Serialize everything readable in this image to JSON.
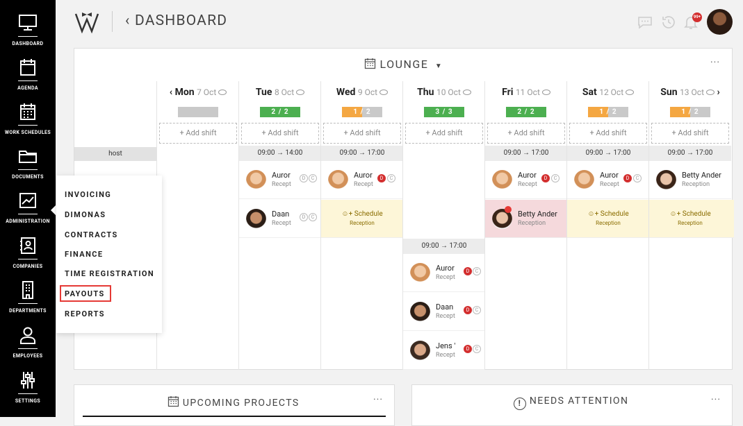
{
  "sidebar": {
    "items": [
      {
        "label": "DASHBOARD",
        "icon": "monitor-icon"
      },
      {
        "label": "AGENDA",
        "icon": "calendar-icon"
      },
      {
        "label": "WORK SCHEDULES",
        "icon": "schedule-grid-icon"
      },
      {
        "label": "DOCUMENTS",
        "icon": "folder-icon"
      },
      {
        "label": "ADMINISTRATION",
        "icon": "chart-icon"
      },
      {
        "label": "COMPANIES",
        "icon": "contact-book-icon"
      },
      {
        "label": "DEPARTMENTS",
        "icon": "building-icon"
      },
      {
        "label": "EMPLOYEES",
        "icon": "person-icon"
      },
      {
        "label": "SETTINGS",
        "icon": "sliders-icon"
      }
    ]
  },
  "header": {
    "title": "DASHBOARD",
    "notification_badge": "99+"
  },
  "schedule": {
    "location": "LOUNGE",
    "row_label": "host",
    "days": [
      {
        "day": "Mon",
        "date": "7 Oct",
        "bar": "",
        "bar_color": "#c9c9c9",
        "add": "+ Add shift",
        "time_start": "",
        "time_end": ""
      },
      {
        "day": "Tue",
        "date": "8 Oct",
        "bar": "2 / 2",
        "bar_color": "#4caf50",
        "add": "+ Add shift",
        "time_start": "09:00",
        "time_end": "14:00"
      },
      {
        "day": "Wed",
        "date": "9 Oct",
        "bar": "1 / 2",
        "bar_color": "#f4a742",
        "add": "+ Add shift",
        "time_start": "09:00",
        "time_end": "17:00"
      },
      {
        "day": "Thu",
        "date": "10 Oct",
        "bar": "3 / 3",
        "bar_color": "#4caf50",
        "add": "+ Add shift",
        "time_start": "",
        "time_end": ""
      },
      {
        "day": "Fri",
        "date": "11 Oct",
        "bar": "2 / 2",
        "bar_color": "#4caf50",
        "add": "+ Add shift",
        "time_start": "09:00",
        "time_end": "17:00"
      },
      {
        "day": "Sat",
        "date": "12 Oct",
        "bar": "1 / 2",
        "bar_color": "#f4a742",
        "add": "+ Add shift",
        "time_start": "09:00",
        "time_end": "17:00"
      },
      {
        "day": "Sun",
        "date": "13 Oct",
        "bar": "1 / 2",
        "bar_color": "#f4a742",
        "add": "+ Add shift",
        "time_start": "09:00",
        "time_end": "17:00"
      }
    ],
    "thu_time_start": "09:00",
    "thu_time_end": "17:00",
    "names": {
      "auror": "Auror",
      "daan": "Daan",
      "betty": "Betty Ander",
      "jens": "Jens '",
      "recept": "Recept",
      "reception": "Reception",
      "schedule": "Schedule"
    }
  },
  "admin_menu": {
    "items": [
      "INVOICING",
      "DIMONAS",
      "CONTRACTS",
      "FINANCE",
      "TIME REGISTRATION",
      "PAYOUTS",
      "REPORTS"
    ],
    "highlighted": "PAYOUTS"
  },
  "panels": {
    "upcoming": "UPCOMING PROJECTS",
    "attention": "NEEDS ATTENTION"
  },
  "colors": {
    "sidebar_bg": "#000000",
    "highlight": "#e53935",
    "green": "#4caf50",
    "orange": "#f4a742",
    "schedule_bg": "#fdf6d8",
    "badge": "#d32f2f"
  }
}
